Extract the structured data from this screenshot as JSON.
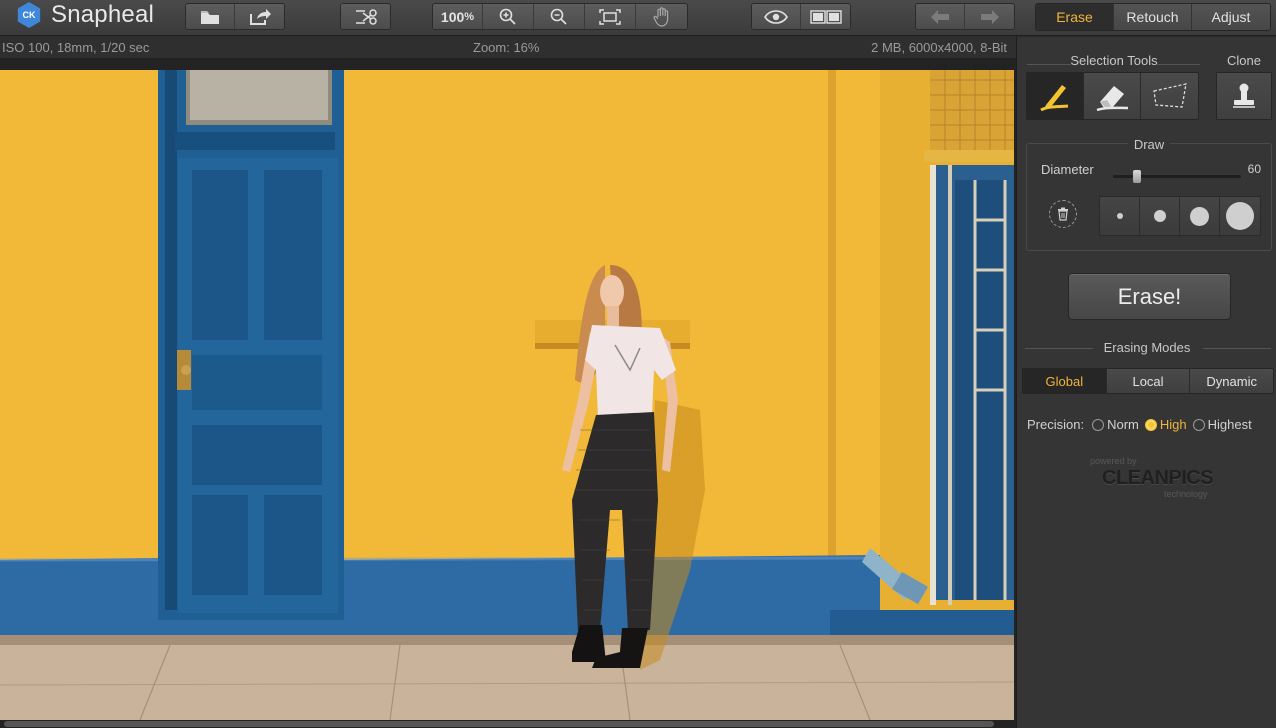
{
  "app": {
    "name": "Snapheal",
    "logo_badge": "CK"
  },
  "toolbar": {
    "zoom_value": "100",
    "zoom_unit": "%"
  },
  "mode_tabs": [
    {
      "label": "Erase",
      "active": true
    },
    {
      "label": "Retouch",
      "active": false
    },
    {
      "label": "Adjust",
      "active": false
    }
  ],
  "infobar": {
    "exif": "ISO 100, 18mm, 1/20 sec",
    "zoom": "Zoom: 16%",
    "file_info": "2 MB, 6000x4000, 8-Bit"
  },
  "panel": {
    "selection_tools_title": "Selection Tools",
    "clone_title": "Clone",
    "draw_title": "Draw",
    "diameter_label": "Diameter",
    "diameter_value": "60",
    "diameter_level": 0.17,
    "erase_button": "Erase!",
    "erasing_modes_title": "Erasing Modes",
    "modes": [
      {
        "label": "Global",
        "active": true
      },
      {
        "label": "Local",
        "active": false
      },
      {
        "label": "Dynamic",
        "active": false
      }
    ],
    "precision_label": "Precision:",
    "precision_options": [
      {
        "label": "Norm",
        "selected": false
      },
      {
        "label": "High",
        "selected": true
      },
      {
        "label": "Highest",
        "selected": false
      }
    ],
    "powered_by": "powered by",
    "powered_brand": "CLEANPICS",
    "powered_tech": "technology"
  },
  "colors": {
    "accent": "#f0b53a",
    "wall_yellow": "#f1b937",
    "door_blue": "#1f5f93"
  }
}
